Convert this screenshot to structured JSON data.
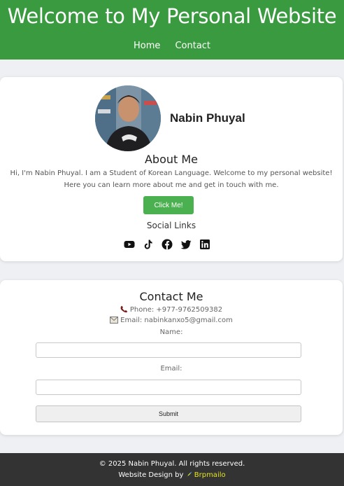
{
  "header": {
    "title": "Welcome to My Personal Website",
    "nav": [
      "Home",
      "Contact"
    ],
    "bg_color": "#3a9a3f"
  },
  "profile": {
    "name": "Nabin Phuyal",
    "avatar_icon": "profile-photo"
  },
  "about": {
    "heading": "About Me",
    "text": "Hi, I'm Nabin Phuyal. I am a Student of Korean Language. Welcome to my personal website! Here you can learn more about me and get in touch with me.",
    "button_label": "Click Me!",
    "button_color": "#4bb04f",
    "social_heading": "Social Links",
    "social_icons": [
      "youtube-icon",
      "tiktok-icon",
      "facebook-icon",
      "twitter-icon",
      "linkedin-icon"
    ]
  },
  "contact": {
    "heading": "Contact Me",
    "phone": "Phone: +977-9762509382",
    "email": "Email: nabinkanxo5@gmail.com",
    "name_label": "Name:",
    "email_label": "Email:",
    "submit_label": "Submit"
  },
  "footer": {
    "copyright": "© 2025 Nabin Phuyal. All rights reserved.",
    "credit_prefix": "Website Design by",
    "credit_brand": "Brpmailo",
    "credit_brand_color": "#e3e51c"
  }
}
